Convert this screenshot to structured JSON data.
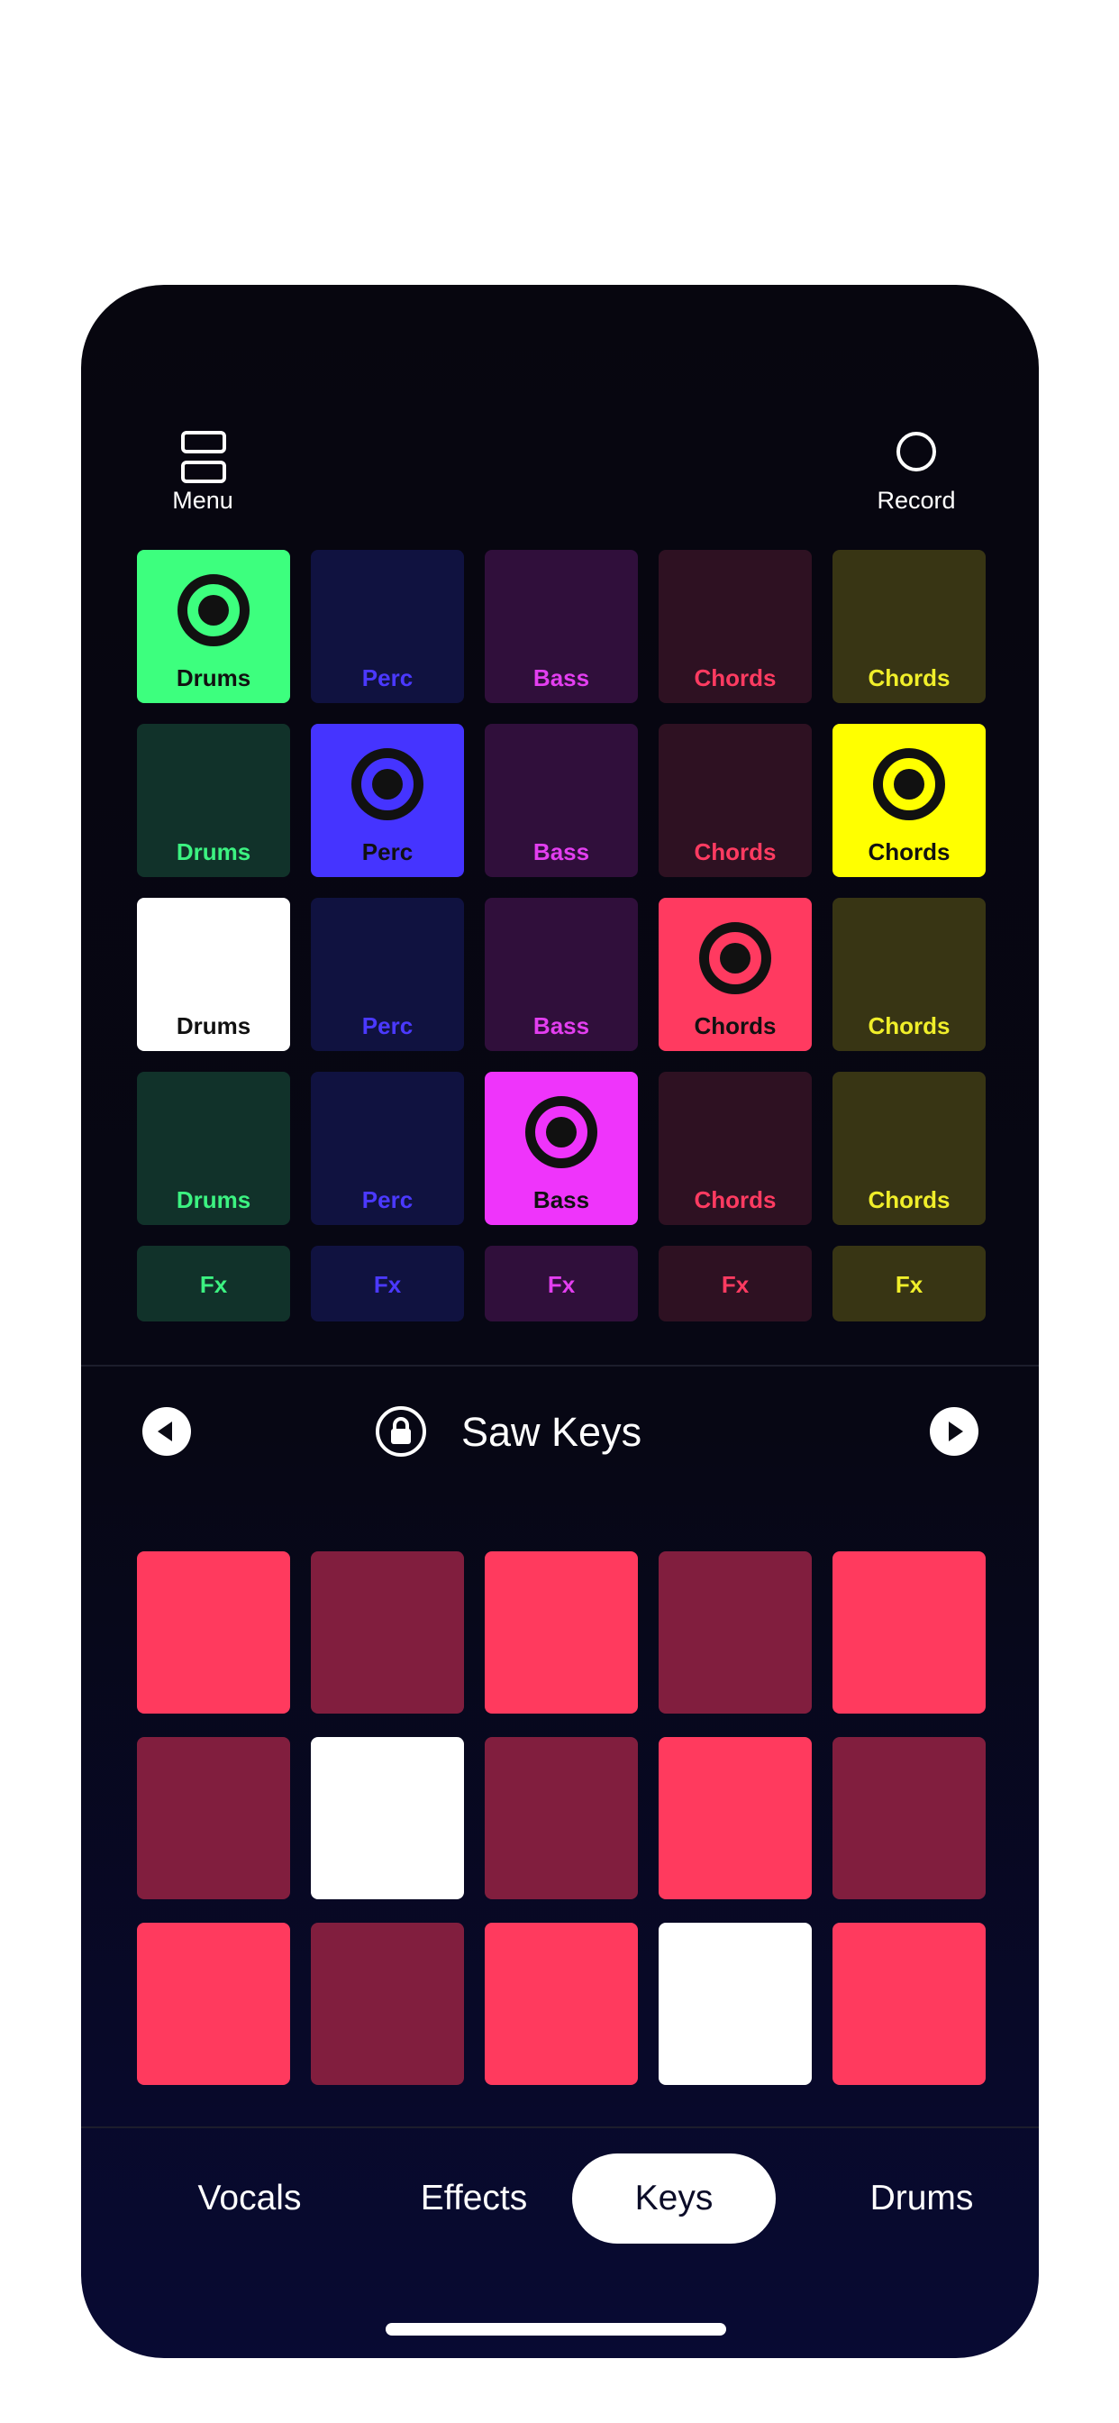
{
  "header": {
    "menu_label": "Menu",
    "record_label": "Record"
  },
  "pad_grid": {
    "columns": [
      {
        "name": "Drums",
        "dim": "#11322a",
        "text": "#3cf281",
        "bright": "#3dff7e"
      },
      {
        "name": "Perc",
        "dim": "#101240",
        "text": "#4b39ff",
        "bright": "#4534ff"
      },
      {
        "name": "Bass",
        "dim": "#300f3b",
        "text": "#e33ef0",
        "bright": "#ef34fb"
      },
      {
        "name": "Chords",
        "dim": "#2e1122",
        "text": "#ff3b61",
        "bright": "#ff3a60"
      },
      {
        "name": "Chords",
        "dim": "#383514",
        "text": "#f0ee2a",
        "bright": "#ffff00"
      }
    ],
    "rows": [
      [
        "playing",
        "off",
        "off",
        "off",
        "off"
      ],
      [
        "off",
        "playing",
        "off",
        "off",
        "playing"
      ],
      [
        "queued",
        "off",
        "off",
        "playing",
        "off"
      ],
      [
        "off",
        "off",
        "playing",
        "off",
        "off"
      ]
    ],
    "fx_label": "Fx"
  },
  "preset": {
    "name": "Saw Keys",
    "locked": true
  },
  "key_pads": {
    "colors": {
      "on": "#ff3a5e",
      "dim": "#811e3e",
      "pressed": "#ffffff"
    },
    "rows": [
      [
        "on",
        "dim",
        "on",
        "dim",
        "on"
      ],
      [
        "dim",
        "pressed",
        "dim",
        "on",
        "dim"
      ],
      [
        "on",
        "dim",
        "on",
        "pressed",
        "on"
      ]
    ]
  },
  "tabs": [
    {
      "label": "Vocals",
      "active": false
    },
    {
      "label": "Effects",
      "active": false
    },
    {
      "label": "Keys",
      "active": true
    },
    {
      "label": "Drums",
      "active": false
    }
  ]
}
